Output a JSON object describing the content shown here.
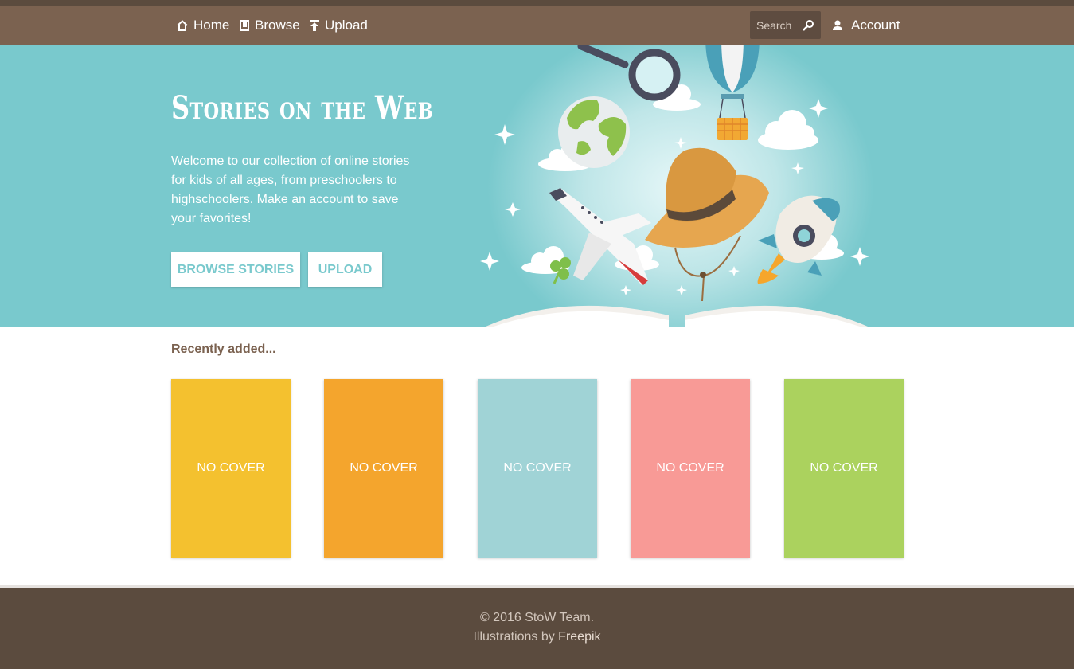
{
  "nav": {
    "home_label": "Home",
    "browse_label": "Browse",
    "upload_label": "Upload",
    "search_placeholder": "Search",
    "account_label": "Account"
  },
  "hero": {
    "title": "Stories on the Web",
    "description": "Welcome to our collection of online stories for kids of all ages, from preschoolers to highschoolers. Make an account to save your favorites!",
    "browse_button": "BROWSE STORIES",
    "upload_button": "UPLOAD"
  },
  "recent": {
    "title": "Recently added...",
    "cards": [
      {
        "label": "NO COVER",
        "color": "#f4c12f"
      },
      {
        "label": "NO COVER",
        "color": "#f4a52d"
      },
      {
        "label": "NO COVER",
        "color": "#a0d3d6"
      },
      {
        "label": "NO COVER",
        "color": "#f89a96"
      },
      {
        "label": "NO COVER",
        "color": "#abd25e"
      }
    ]
  },
  "footer": {
    "copyright": "© 2016 StoW Team.",
    "credit_prefix": "Illustrations by ",
    "credit_link": "Freepik"
  },
  "colors": {
    "navbar": "#7b6250",
    "hero": "#79c9cd",
    "footer": "#5b4b3e"
  },
  "icons": [
    "home-icon",
    "book-icon",
    "upload-icon",
    "search-icon",
    "user-icon"
  ]
}
